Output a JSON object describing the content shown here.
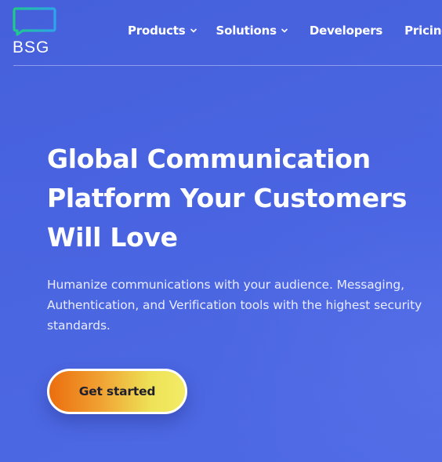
{
  "brand": {
    "name": "BSG",
    "logo_colors": [
      "#1ec48a",
      "#2fa6e8"
    ]
  },
  "nav": {
    "items": [
      {
        "label": "Products",
        "has_dropdown": true,
        "icon": "chevron-down-icon"
      },
      {
        "label": "Solutions",
        "has_dropdown": true,
        "icon": "chevron-down-icon"
      },
      {
        "label": "Developers",
        "has_dropdown": false
      },
      {
        "label": "Pricing",
        "has_dropdown": false
      }
    ]
  },
  "hero": {
    "title": "Global Communication Platform Your Customers Will Love",
    "subtitle": "Humanize communications with your audience. Messaging, Authentication, and Verification tools with the highest security standards.",
    "cta_label": "Get started"
  },
  "colors": {
    "background": "#4a63df",
    "cta_gradient_start": "#ec6e0e",
    "cta_gradient_end": "#f3ec66",
    "text": "#ffffff"
  }
}
